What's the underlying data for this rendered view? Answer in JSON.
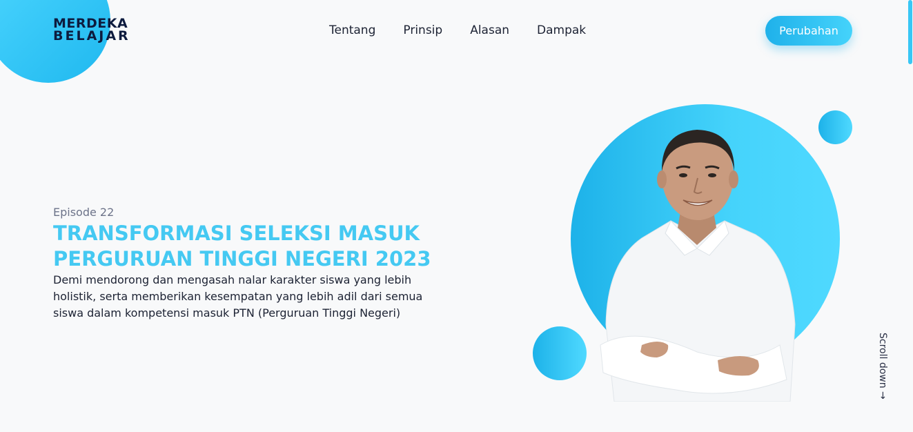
{
  "logo": {
    "line1": "MERDEKA",
    "line2": "BELAJAR"
  },
  "nav": {
    "items": [
      {
        "label": "Tentang"
      },
      {
        "label": "Prinsip"
      },
      {
        "label": "Alasan"
      },
      {
        "label": "Dampak"
      }
    ]
  },
  "cta": {
    "label": "Perubahan"
  },
  "hero": {
    "episode": "Episode 22",
    "headline_line1": "TRANSFORMASI SELEKSI MASUK",
    "headline_line2": "PERGURUAN TINGGI NEGERI 2023",
    "description": "Demi mendorong dan mengasah nalar karakter siswa yang lebih holistik, serta memberikan kesempatan yang lebih adil dari semua siswa dalam kompetensi masuk PTN (Perguruan Tinggi Negeri)"
  },
  "scroll_hint": {
    "label": "Scroll down →"
  },
  "colors": {
    "accent": "#45c9f2",
    "accent_dark": "#1fb1ea",
    "text_dark": "#1c2233",
    "logo": "#0d1b3e",
    "background": "#f8f9fa"
  }
}
